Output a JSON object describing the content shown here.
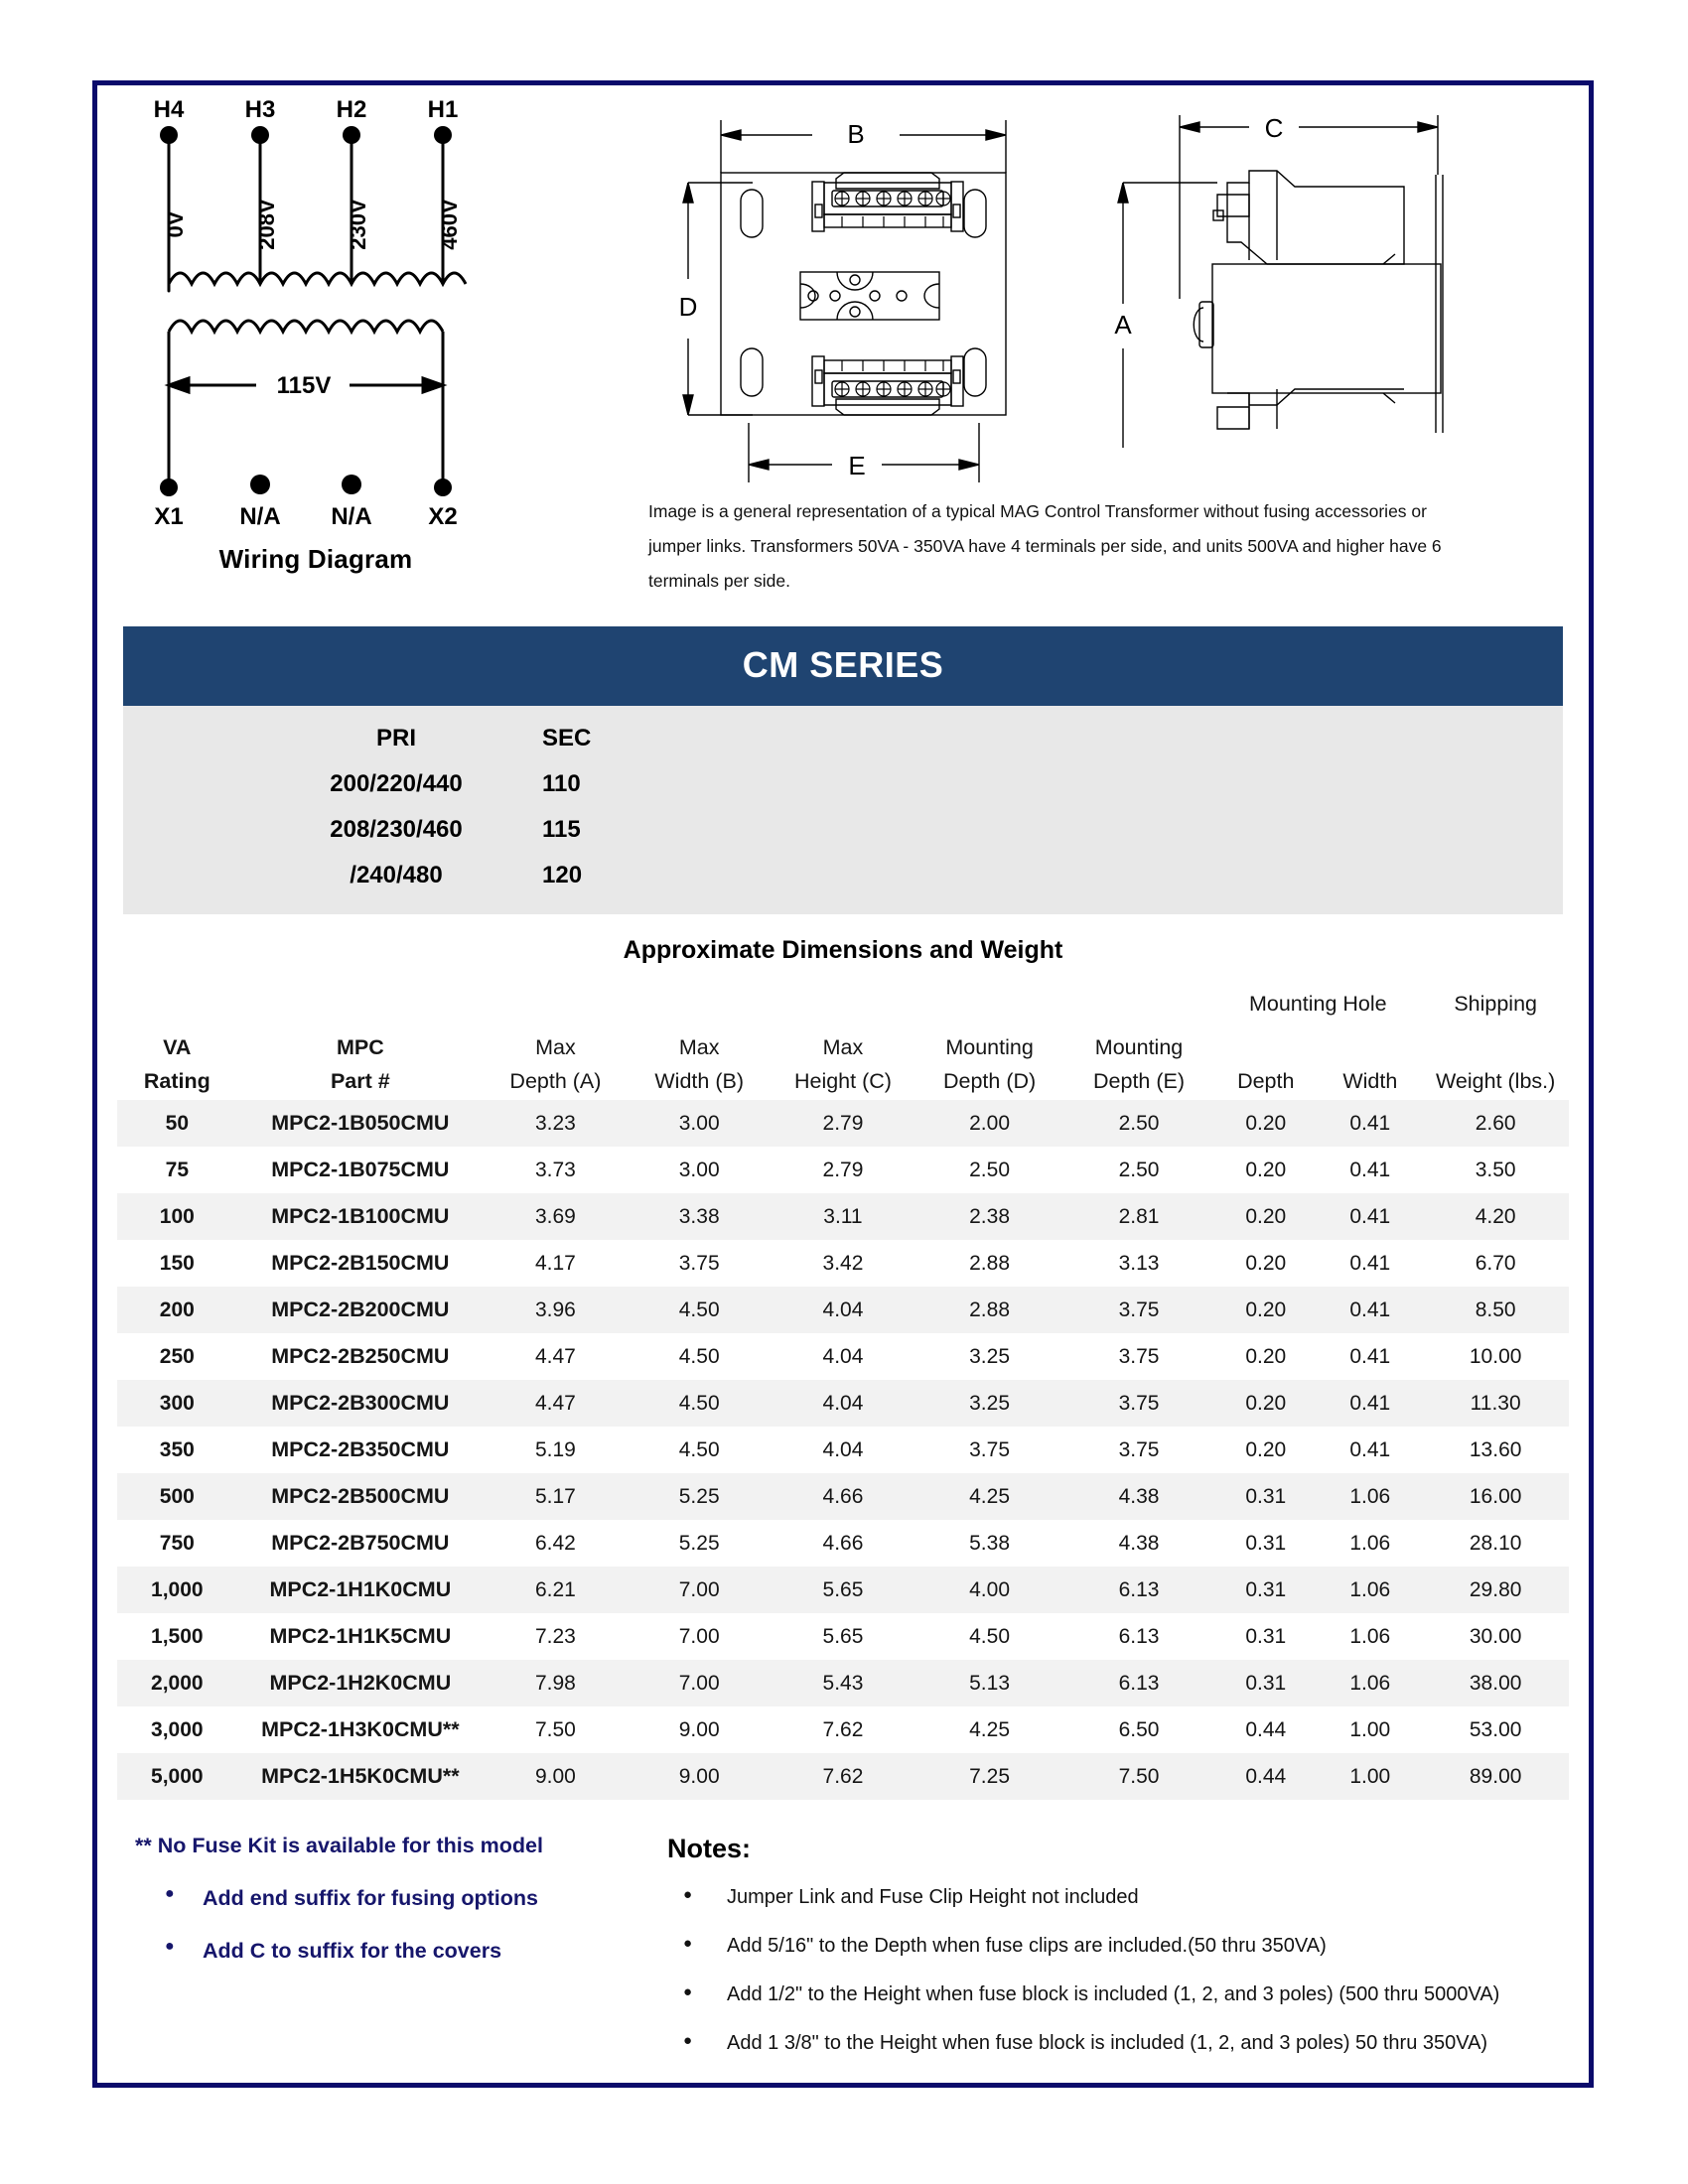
{
  "wiring": {
    "caption": "Wiring Diagram",
    "primary_terminals": [
      "H4",
      "H3",
      "H2",
      "H1"
    ],
    "primary_taps": [
      "0V",
      "208V",
      "230V",
      "460V"
    ],
    "secondary_voltage": "115V",
    "secondary_terminals": [
      "X1",
      "N/A",
      "N/A",
      "X2"
    ]
  },
  "topview": {
    "dim_width": "B",
    "dim_depth": "D",
    "dim_mount": "E"
  },
  "sideview": {
    "dim_height": "C",
    "dim_depth": "A"
  },
  "image_note": "Image is a general representation of a typical MAG Control Transformer   without fusing accessories or jumper links.  Transformers 50VA - 350VA  have 4 terminals per side, and units 500VA and higher have 6 terminals per side.",
  "banner": {
    "title": "CM SERIES",
    "color": "#1f4471"
  },
  "prisec": {
    "header": {
      "pri": "PRI",
      "sec": "SEC"
    },
    "rows": [
      {
        "pri": "200/220/440",
        "sec": "110"
      },
      {
        "pri": "208/230/460",
        "sec": "115"
      },
      {
        "pri": "/240/480",
        "sec": "120"
      }
    ]
  },
  "table": {
    "title": "Approximate Dimensions and Weight",
    "group_headers": {
      "mounting_hole": "Mounting Hole",
      "shipping": "Shipping"
    },
    "headers_line1": [
      "VA",
      "MPC",
      "Max",
      "Max",
      "Max",
      "Mounting",
      "Mounting",
      "",
      "",
      ""
    ],
    "headers_line2": [
      "Rating",
      "Part #",
      "Depth (A)",
      "Width (B)",
      "Height (C)",
      "Depth (D)",
      "Depth (E)",
      "Depth",
      "Width",
      "Weight (lbs.)"
    ],
    "rows": [
      {
        "va": "50",
        "pn": "MPC2-1B050CMU",
        "a": "3.23",
        "b": "3.00",
        "c": "2.79",
        "d": "2.00",
        "e": "2.50",
        "hd": "0.20",
        "hw": "0.41",
        "wt": "2.60"
      },
      {
        "va": "75",
        "pn": "MPC2-1B075CMU",
        "a": "3.73",
        "b": "3.00",
        "c": "2.79",
        "d": "2.50",
        "e": "2.50",
        "hd": "0.20",
        "hw": "0.41",
        "wt": "3.50"
      },
      {
        "va": "100",
        "pn": "MPC2-1B100CMU",
        "a": "3.69",
        "b": "3.38",
        "c": "3.11",
        "d": "2.38",
        "e": "2.81",
        "hd": "0.20",
        "hw": "0.41",
        "wt": "4.20"
      },
      {
        "va": "150",
        "pn": "MPC2-2B150CMU",
        "a": "4.17",
        "b": "3.75",
        "c": "3.42",
        "d": "2.88",
        "e": "3.13",
        "hd": "0.20",
        "hw": "0.41",
        "wt": "6.70"
      },
      {
        "va": "200",
        "pn": "MPC2-2B200CMU",
        "a": "3.96",
        "b": "4.50",
        "c": "4.04",
        "d": "2.88",
        "e": "3.75",
        "hd": "0.20",
        "hw": "0.41",
        "wt": "8.50"
      },
      {
        "va": "250",
        "pn": "MPC2-2B250CMU",
        "a": "4.47",
        "b": "4.50",
        "c": "4.04",
        "d": "3.25",
        "e": "3.75",
        "hd": "0.20",
        "hw": "0.41",
        "wt": "10.00"
      },
      {
        "va": "300",
        "pn": "MPC2-2B300CMU",
        "a": "4.47",
        "b": "4.50",
        "c": "4.04",
        "d": "3.25",
        "e": "3.75",
        "hd": "0.20",
        "hw": "0.41",
        "wt": "11.30"
      },
      {
        "va": "350",
        "pn": "MPC2-2B350CMU",
        "a": "5.19",
        "b": "4.50",
        "c": "4.04",
        "d": "3.75",
        "e": "3.75",
        "hd": "0.20",
        "hw": "0.41",
        "wt": "13.60"
      },
      {
        "va": "500",
        "pn": "MPC2-2B500CMU",
        "a": "5.17",
        "b": "5.25",
        "c": "4.66",
        "d": "4.25",
        "e": "4.38",
        "hd": "0.31",
        "hw": "1.06",
        "wt": "16.00"
      },
      {
        "va": "750",
        "pn": "MPC2-2B750CMU",
        "a": "6.42",
        "b": "5.25",
        "c": "4.66",
        "d": "5.38",
        "e": "4.38",
        "hd": "0.31",
        "hw": "1.06",
        "wt": "28.10"
      },
      {
        "va": "1,000",
        "pn": "MPC2-1H1K0CMU",
        "a": "6.21",
        "b": "7.00",
        "c": "5.65",
        "d": "4.00",
        "e": "6.13",
        "hd": "0.31",
        "hw": "1.06",
        "wt": "29.80"
      },
      {
        "va": "1,500",
        "pn": "MPC2-1H1K5CMU",
        "a": "7.23",
        "b": "7.00",
        "c": "5.65",
        "d": "4.50",
        "e": "6.13",
        "hd": "0.31",
        "hw": "1.06",
        "wt": "30.00"
      },
      {
        "va": "2,000",
        "pn": "MPC2-1H2K0CMU",
        "a": "7.98",
        "b": "7.00",
        "c": "5.43",
        "d": "5.13",
        "e": "6.13",
        "hd": "0.31",
        "hw": "1.06",
        "wt": "38.00"
      },
      {
        "va": "3,000",
        "pn": "MPC2-1H3K0CMU**",
        "a": "7.50",
        "b": "9.00",
        "c": "7.62",
        "d": "4.25",
        "e": "6.50",
        "hd": "0.44",
        "hw": "1.00",
        "wt": "53.00"
      },
      {
        "va": "5,000",
        "pn": "MPC2-1H5K0CMU**",
        "a": "9.00",
        "b": "9.00",
        "c": "7.62",
        "d": "7.25",
        "e": "7.50",
        "hd": "0.44",
        "hw": "1.00",
        "wt": "89.00"
      }
    ]
  },
  "footer": {
    "fuse_kit_note": "** No Fuse Kit is available for this model",
    "blue_bullets": [
      "Add end suffix for fusing options",
      "Add C to suffix for the covers"
    ],
    "notes_title": "Notes:",
    "notes": [
      "Jumper Link and Fuse Clip Height not included",
      "Add 5/16\" to the Depth when fuse clips are included.(50 thru 350VA)",
      "Add 1/2\" to the Height when fuse block is included (1, 2, and 3 poles)    (500 thru 5000VA)",
      "Add 1 3/8\" to the Height when fuse block is included (1, 2, and 3 poles)  50 thru 350VA)"
    ]
  },
  "colors": {
    "border": "#0b0b6b",
    "banner": "#1f4471",
    "blue_text": "#16166b",
    "alt_row": "#f2f2f2",
    "prisec_bg": "#e8e8e8"
  }
}
